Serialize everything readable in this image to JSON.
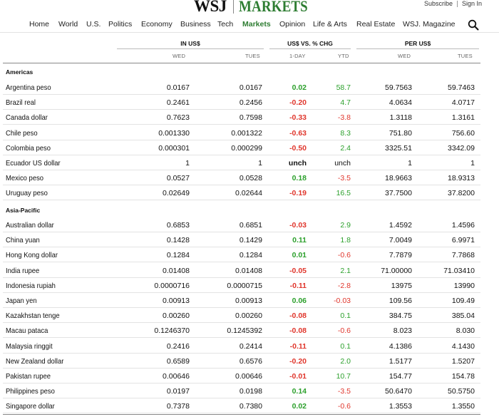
{
  "masthead": {
    "brand": "WSJ",
    "section": "MARKETS",
    "subscribe": "Subscribe",
    "sign_in": "Sign In"
  },
  "nav": {
    "items": [
      "Home",
      "World",
      "U.S.",
      "Politics",
      "Economy",
      "Business",
      "Tech",
      "Markets",
      "Opinion",
      "Life & Arts",
      "Real Estate",
      "WSJ. Magazine"
    ],
    "active": "Markets",
    "search_icon": "search-icon"
  },
  "colors": {
    "brand_green": "#2e7d32",
    "gain": "#2ca02c",
    "loss": "#e0362c"
  },
  "table": {
    "groups": {
      "in_usd": "IN US$",
      "chg": "US$ VS. % CHG",
      "per_usd": "PER US$"
    },
    "subheaders": {
      "in_wed": "WED",
      "in_tue": "TUES",
      "day": "1-DAY",
      "ytd": "YTD",
      "per_wed": "WED",
      "per_tue": "TUES"
    },
    "sections": [
      {
        "title": "Americas",
        "rows": [
          {
            "name": "Argentina peso",
            "wed": "0.0167",
            "tue": "0.0167",
            "day": "0.02",
            "ytd": "58.7",
            "pwed": "59.7563",
            "ptue": "59.7463"
          },
          {
            "name": "Brazil real",
            "wed": "0.2461",
            "tue": "0.2456",
            "day": "-0.20",
            "ytd": "4.7",
            "pwed": "4.0634",
            "ptue": "4.0717"
          },
          {
            "name": "Canada dollar",
            "wed": "0.7623",
            "tue": "0.7598",
            "day": "-0.33",
            "ytd": "-3.8",
            "pwed": "1.3118",
            "ptue": "1.3161"
          },
          {
            "name": "Chile peso",
            "wed": "0.001330",
            "tue": "0.001322",
            "day": "-0.63",
            "ytd": "8.3",
            "pwed": "751.80",
            "ptue": "756.60"
          },
          {
            "name": "Colombia peso",
            "wed": "0.000301",
            "tue": "0.000299",
            "day": "-0.50",
            "ytd": "2.4",
            "pwed": "3325.51",
            "ptue": "3342.09"
          },
          {
            "name": "Ecuador US dollar",
            "wed": "1",
            "tue": "1",
            "day": "unch",
            "ytd": "unch",
            "pwed": "1",
            "ptue": "1"
          },
          {
            "name": "Mexico peso",
            "wed": "0.0527",
            "tue": "0.0528",
            "day": "0.18",
            "ytd": "-3.5",
            "pwed": "18.9663",
            "ptue": "18.9313"
          },
          {
            "name": "Uruguay peso",
            "wed": "0.02649",
            "tue": "0.02644",
            "day": "-0.19",
            "ytd": "16.5",
            "pwed": "37.7500",
            "ptue": "37.8200"
          }
        ]
      },
      {
        "title": "Asia-Pacific",
        "rows": [
          {
            "name": "Australian dollar",
            "wed": "0.6853",
            "tue": "0.6851",
            "day": "-0.03",
            "ytd": "2.9",
            "pwed": "1.4592",
            "ptue": "1.4596"
          },
          {
            "name": "China yuan",
            "wed": "0.1428",
            "tue": "0.1429",
            "day": "0.11",
            "ytd": "1.8",
            "pwed": "7.0049",
            "ptue": "6.9971"
          },
          {
            "name": "Hong Kong dollar",
            "wed": "0.1284",
            "tue": "0.1284",
            "day": "0.01",
            "ytd": "-0.6",
            "pwed": "7.7879",
            "ptue": "7.7868"
          },
          {
            "name": "India rupee",
            "wed": "0.01408",
            "tue": "0.01408",
            "day": "-0.05",
            "ytd": "2.1",
            "pwed": "71.00000",
            "ptue": "71.03410"
          },
          {
            "name": "Indonesia rupiah",
            "wed": "0.0000716",
            "tue": "0.0000715",
            "day": "-0.11",
            "ytd": "-2.8",
            "pwed": "13975",
            "ptue": "13990"
          },
          {
            "name": "Japan yen",
            "wed": "0.00913",
            "tue": "0.00913",
            "day": "0.06",
            "ytd": "-0.03",
            "pwed": "109.56",
            "ptue": "109.49"
          },
          {
            "name": "Kazakhstan tenge",
            "wed": "0.00260",
            "tue": "0.00260",
            "day": "-0.08",
            "ytd": "0.1",
            "pwed": "384.75",
            "ptue": "385.04"
          },
          {
            "name": "Macau pataca",
            "wed": "0.1246370",
            "tue": "0.1245392",
            "day": "-0.08",
            "ytd": "-0.6",
            "pwed": "8.023",
            "ptue": "8.030"
          },
          {
            "name": "Malaysia ringgit",
            "wed": "0.2416",
            "tue": "0.2414",
            "day": "-0.11",
            "ytd": "0.1",
            "pwed": "4.1386",
            "ptue": "4.1430"
          },
          {
            "name": "New Zealand dollar",
            "wed": "0.6589",
            "tue": "0.6576",
            "day": "-0.20",
            "ytd": "2.0",
            "pwed": "1.5177",
            "ptue": "1.5207"
          },
          {
            "name": "Pakistan rupee",
            "wed": "0.00646",
            "tue": "0.00646",
            "day": "-0.01",
            "ytd": "10.7",
            "pwed": "154.77",
            "ptue": "154.78"
          },
          {
            "name": "Philippines peso",
            "wed": "0.0197",
            "tue": "0.0198",
            "day": "0.14",
            "ytd": "-3.5",
            "pwed": "50.6470",
            "ptue": "50.5750"
          },
          {
            "name": "Singapore dollar",
            "wed": "0.7378",
            "tue": "0.7380",
            "day": "0.02",
            "ytd": "-0.6",
            "pwed": "1.3553",
            "ptue": "1.3550"
          }
        ]
      }
    ]
  }
}
